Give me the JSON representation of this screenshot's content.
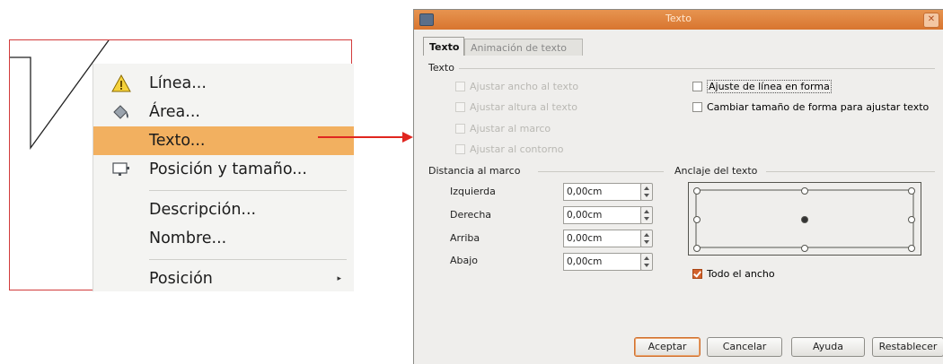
{
  "context_menu": {
    "items": [
      {
        "label": "Línea...",
        "icon": "warning-triangle-icon"
      },
      {
        "label": "Área...",
        "icon": "paint-bucket-icon"
      },
      {
        "label": "Texto...",
        "icon": ""
      },
      {
        "label": "Posición y tamaño...",
        "icon": "position-size-icon"
      },
      {
        "label": "Descripción...",
        "icon": ""
      },
      {
        "label": "Nombre...",
        "icon": ""
      },
      {
        "label": "Posición",
        "icon": "submenu-arrow-icon"
      }
    ],
    "highlighted": "Texto...",
    "submenu_arrow": "▸"
  },
  "dialog": {
    "title": "Texto",
    "close_glyph": "✕",
    "tabs": [
      "Texto",
      "Animación de texto"
    ],
    "active_tab": "Texto",
    "section_texto": "Texto",
    "checkboxes_left": [
      {
        "label": "Ajustar ancho al texto",
        "checked": false,
        "enabled": false
      },
      {
        "label": "Ajustar altura al texto",
        "checked": false,
        "enabled": false
      },
      {
        "label": "Ajustar al marco",
        "checked": false,
        "enabled": false
      },
      {
        "label": "Ajustar al contorno",
        "checked": false,
        "enabled": false
      }
    ],
    "checkboxes_right": [
      {
        "label": "Ajuste de línea en forma",
        "checked": false,
        "enabled": true
      },
      {
        "label": "Cambiar tamaño de forma para ajustar texto",
        "checked": false,
        "enabled": true
      }
    ],
    "section_distancia": "Distancia al marco",
    "spacing_fields": [
      {
        "label": "Izquierda",
        "value": "0,00cm"
      },
      {
        "label": "Derecha",
        "value": "0,00cm"
      },
      {
        "label": "Arriba",
        "value": "0,00cm"
      },
      {
        "label": "Abajo",
        "value": "0,00cm"
      }
    ],
    "section_anclaje": "Anclaje del texto",
    "full_width_checkbox": {
      "label": "Todo el ancho",
      "checked": true
    },
    "buttons": {
      "ok": "Aceptar",
      "cancel": "Cancelar",
      "help": "Ayuda",
      "reset": "Restablecer"
    },
    "colors": {
      "titlebar": "#d8752f",
      "accent_check": "#d2622c",
      "highlight": "#f2b060",
      "frame_red": "#d23b3b"
    }
  }
}
